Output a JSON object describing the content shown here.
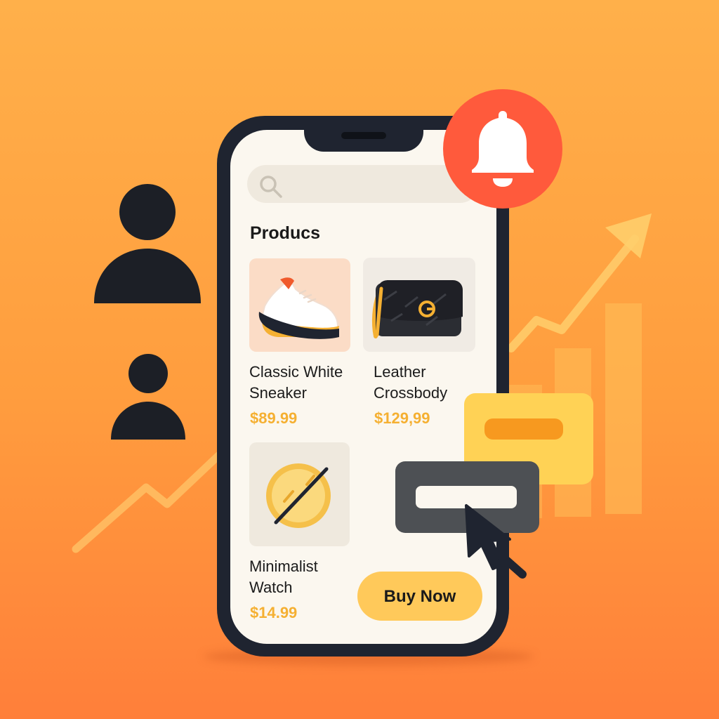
{
  "search": {
    "icon": "search-icon",
    "placeholder": ""
  },
  "products_section": {
    "title": "Producs"
  },
  "products": [
    {
      "name_line1": "Classic White",
      "name_line2": "Sneaker",
      "price": "$89.99",
      "image": "sneaker-image"
    },
    {
      "name_line1": "Leather",
      "name_line2": "Crossbody",
      "price": "$129,99",
      "image": "crossbody-bag-image"
    },
    {
      "name_line1": "Minimalist",
      "name_line2": "Watch",
      "price": "$14.99",
      "image": "watch-image"
    }
  ],
  "cta": {
    "buy_label": "Buy Now"
  },
  "notification": {
    "icon": "bell-icon"
  },
  "colors": {
    "background_top": "#ffb04a",
    "background_bottom": "#ff7f3a",
    "phone_frame": "#1f2430",
    "screen": "#fbf7ef",
    "accent_price": "#f5b032",
    "buy_button": "#ffc95a",
    "bell_badge": "#ff5a3c"
  }
}
